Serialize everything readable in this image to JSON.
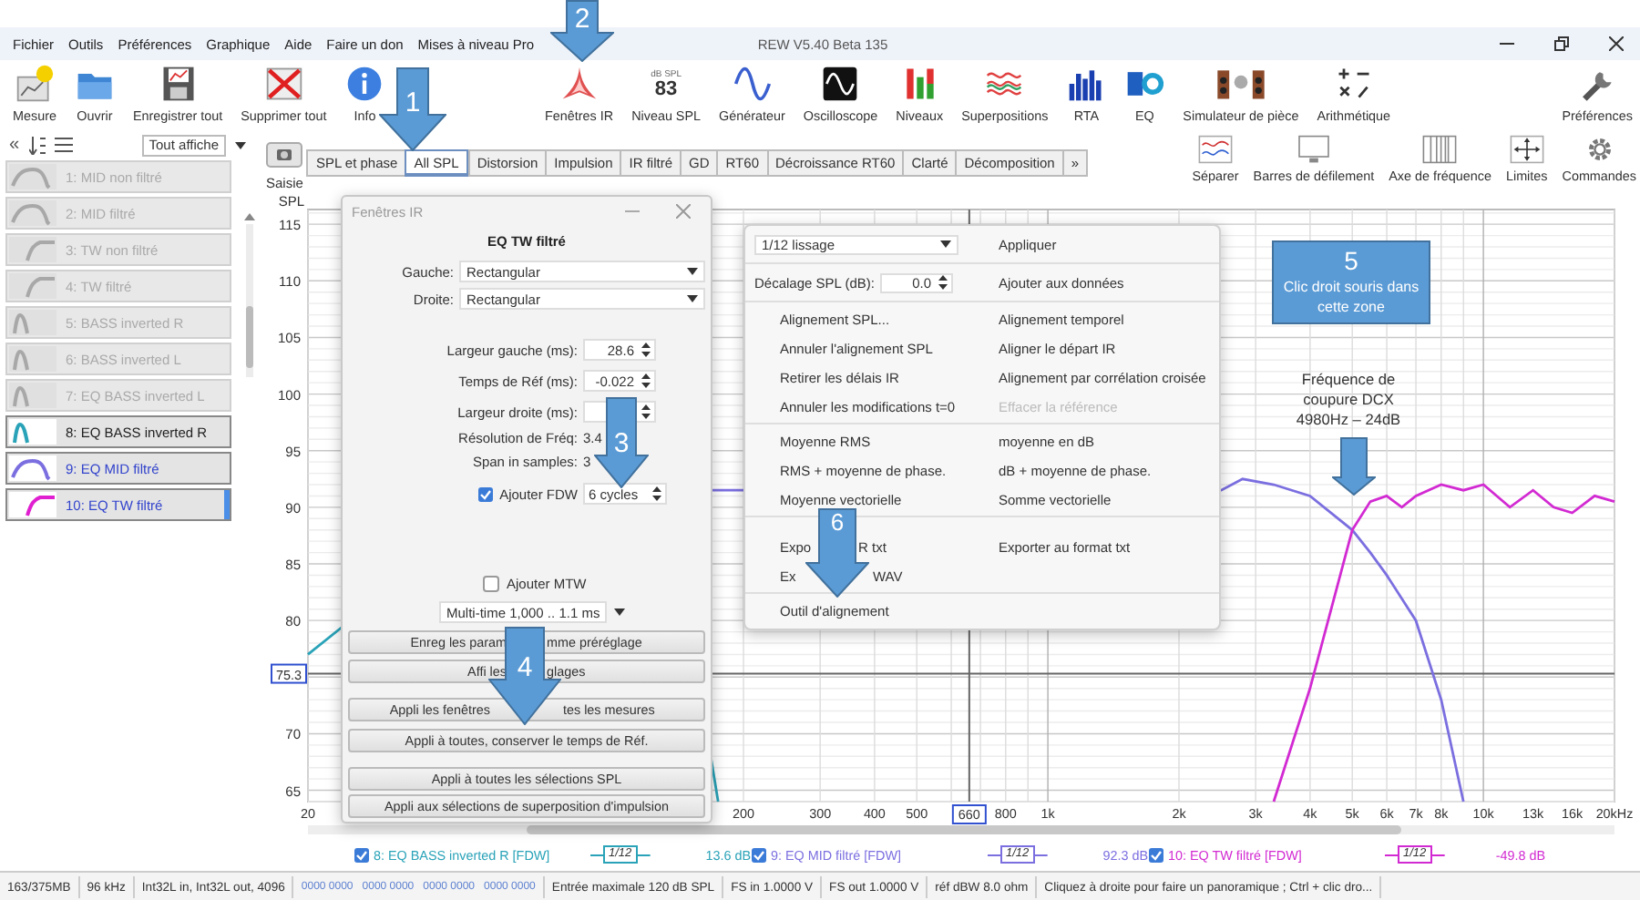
{
  "window": {
    "title": "REW V5.40 Beta 135"
  },
  "menu": [
    "Fichier",
    "Outils",
    "Préférences",
    "Graphique",
    "Aide",
    "Faire un don",
    "Mises à niveau Pro"
  ],
  "toolbar": {
    "left": [
      {
        "kind": "measure",
        "label": "Mesure"
      },
      {
        "kind": "open",
        "label": "Ouvrir"
      },
      {
        "kind": "save",
        "label": "Enregistrer tout"
      },
      {
        "kind": "delete",
        "label": "Supprimer tout"
      },
      {
        "kind": "info",
        "label": "Info"
      }
    ],
    "center": [
      {
        "kind": "ir",
        "label": "Fenêtres IR"
      },
      {
        "kind": "spl",
        "label": "Niveau SPL",
        "readout_unit": "dB SPL",
        "readout": "83"
      },
      {
        "kind": "generator",
        "label": "Générateur"
      },
      {
        "kind": "scope",
        "label": "Oscilloscope"
      },
      {
        "kind": "levels",
        "label": "Niveaux"
      },
      {
        "kind": "overlays",
        "label": "Superpositions"
      },
      {
        "kind": "rta",
        "label": "RTA"
      },
      {
        "kind": "eq",
        "label": "EQ"
      },
      {
        "kind": "room",
        "label": "Simulateur de pièce"
      },
      {
        "kind": "arith",
        "label": "Arithmétique"
      }
    ],
    "right": [
      {
        "kind": "prefs",
        "label": "Préférences"
      }
    ]
  },
  "sidebar": {
    "collapse": "«",
    "filter": "Tout affiche",
    "measurements": [
      {
        "label": "1: MID non filtré",
        "kind": "mid",
        "shown": false,
        "selected": false,
        "current": false,
        "color": "#a8a8a8"
      },
      {
        "label": "2: MID filtré",
        "kind": "mid",
        "shown": false,
        "selected": false,
        "current": false,
        "color": "#a8a8a8"
      },
      {
        "label": "3: TW non filtré",
        "kind": "tw",
        "shown": false,
        "selected": false,
        "current": false,
        "color": "#a8a8a8"
      },
      {
        "label": "4: TW filtré",
        "kind": "tw",
        "shown": false,
        "selected": false,
        "current": false,
        "color": "#a8a8a8"
      },
      {
        "label": "5: BASS inverted R",
        "kind": "bass",
        "shown": false,
        "selected": false,
        "current": false,
        "color": "#a8a8a8"
      },
      {
        "label": "6: BASS inverted L",
        "kind": "bass",
        "shown": false,
        "selected": false,
        "current": false,
        "color": "#a8a8a8"
      },
      {
        "label": "7: EQ BASS inverted L",
        "kind": "bass",
        "shown": false,
        "selected": false,
        "current": false,
        "color": "#a8a8a8"
      },
      {
        "label": "8: EQ BASS inverted R",
        "kind": "bass",
        "shown": true,
        "selected": false,
        "current": false,
        "color": "#2aa3b8"
      },
      {
        "label": "9: EQ MID filtré",
        "kind": "mid",
        "shown": true,
        "selected": true,
        "current": false,
        "color": "#7b6fe0"
      },
      {
        "label": "10: EQ TW filtré",
        "kind": "tw",
        "shown": true,
        "selected": true,
        "current": true,
        "color": "#e020d0"
      }
    ]
  },
  "capture": {
    "label": "Saisie"
  },
  "tabs": [
    {
      "label": "SPL et phase",
      "selected": false
    },
    {
      "label": "All SPL",
      "selected": true
    },
    {
      "label": "Distorsion",
      "selected": false
    },
    {
      "label": "Impulsion",
      "selected": false
    },
    {
      "label": "IR filtré",
      "selected": false
    },
    {
      "label": "GD",
      "selected": false
    },
    {
      "label": "RT60",
      "selected": false
    },
    {
      "label": "Décroissance RT60",
      "selected": false
    },
    {
      "label": "Clarté",
      "selected": false
    },
    {
      "label": "Décomposition",
      "selected": false
    }
  ],
  "tabs_overflow": "»",
  "view_tools": [
    {
      "kind": "split",
      "label": "Séparer"
    },
    {
      "kind": "scrollbars",
      "label": "Barres de défilement"
    },
    {
      "kind": "freq_axis",
      "label": "Axe de fréquence"
    },
    {
      "kind": "limits",
      "label": "Limites"
    },
    {
      "kind": "commands",
      "label": "Commandes"
    }
  ],
  "chart": {
    "y_axis_title": "SPL",
    "y_axis_labels": [
      "115",
      "110",
      "105",
      "100",
      "95",
      "90",
      "85",
      "80",
      "70",
      "65"
    ],
    "x_axis_labels": [
      "20",
      "200",
      "300",
      "400",
      "500",
      "800",
      "1k",
      "2k",
      "3k",
      "4k",
      "5k",
      "6k",
      "7k",
      "8k",
      "10k",
      "13k",
      "16k",
      "20kHz"
    ],
    "cursor": {
      "x_readout": "660",
      "y_readout": "75.3"
    }
  },
  "ir_windows_dialog": {
    "title": "Fenêtres IR",
    "heading": "EQ TW filtré",
    "window_selects": [
      {
        "label": "Gauche:",
        "value": "Rectangular"
      },
      {
        "label": "Droite:",
        "value": "Rectangular"
      }
    ],
    "fields": [
      {
        "kind": "spinner",
        "label": "Largeur gauche (ms):",
        "value": "28.6"
      },
      {
        "kind": "spinner",
        "label": "Temps de Réf (ms):",
        "value": "-0.022"
      },
      {
        "kind": "spinner",
        "label": "Largeur droite (ms):"
      },
      {
        "kind": "readout",
        "label": "Résolution de Fréq:",
        "value": "3.4"
      },
      {
        "kind": "readout",
        "label": "Span in samples:",
        "value": "3"
      }
    ],
    "fdw": {
      "label": "Ajouter FDW",
      "checked": true,
      "value": "6 cycles"
    },
    "mtw": {
      "label": "Ajouter MTW",
      "checked": false
    },
    "multi_time": "Multi-time 1,000 .. 1.1 ms",
    "buttons": [
      {
        "parts": [
          "Enreg les param",
          "mme préréglage"
        ]
      },
      {
        "parts": [
          "Affi les",
          "glages"
        ]
      },
      {
        "parts": [
          "Appli les fenêtres",
          "tes les mesures"
        ]
      },
      {
        "text": "Appli à toutes, conserver le temps de Réf."
      },
      {
        "text": "Appli à toutes les sélections SPL"
      },
      {
        "text": "Appli aux sélections de superposition d'impulsion"
      }
    ]
  },
  "context_menu": {
    "smoothing": {
      "value": "1/12 lissage",
      "action": "Appliquer"
    },
    "offset": {
      "label": "Décalage SPL (dB):",
      "value": "0.0",
      "action": "Ajouter aux données"
    },
    "groups": [
      {
        "left": [
          {
            "label": "Alignement SPL...",
            "disabled": false
          },
          {
            "label": "Annuler l'alignement SPL",
            "disabled": false
          },
          {
            "label": "Retirer les délais IR",
            "disabled": false
          },
          {
            "label": "Annuler les modifications t=0",
            "disabled": false
          }
        ],
        "right": [
          {
            "label": "Alignement temporel",
            "disabled": false
          },
          {
            "label": "Aligner le départ IR",
            "disabled": false
          },
          {
            "label": "Alignement par corrélation croisée",
            "disabled": false
          },
          {
            "label": "Effacer la référence",
            "disabled": true
          }
        ]
      },
      {
        "left": [
          {
            "label": "Moyenne RMS",
            "disabled": false
          },
          {
            "label": "RMS + moyenne de phase.",
            "disabled": false
          },
          {
            "label": "Moyenne vectorielle",
            "disabled": false
          }
        ],
        "right": [
          {
            "label": "moyenne en dB",
            "disabled": false
          },
          {
            "label": "dB + moyenne de phase.",
            "disabled": false
          },
          {
            "label": "Somme vectorielle",
            "disabled": false
          }
        ]
      },
      {
        "left": [
          {
            "parts": [
              "Expo",
              "R txt"
            ],
            "disabled": false
          },
          {
            "parts": [
              "Ex",
              "WAV"
            ],
            "disabled": false
          }
        ],
        "right": [
          {
            "label": "Exporter au format txt",
            "disabled": false
          }
        ]
      },
      {
        "left": [
          {
            "label": "Outil d'alignement",
            "disabled": false
          }
        ]
      }
    ]
  },
  "callouts": [
    {
      "kind": "arrow",
      "number": "1"
    },
    {
      "kind": "arrow",
      "number": "2"
    },
    {
      "kind": "arrow",
      "number": "3"
    },
    {
      "kind": "arrow",
      "number": "4"
    },
    {
      "kind": "box",
      "number": "5",
      "text": "Clic droit souris dans cette zone"
    },
    {
      "kind": "arrow",
      "number": "6"
    }
  ],
  "note": {
    "text": "Fréquence de coupure DCX 4980Hz – 24dB"
  },
  "legend": [
    {
      "label": "8: EQ BASS inverted R [FDW]",
      "checked": true,
      "smoothing": "1/12",
      "value": "13.6 dB",
      "color": "#2aa3b8"
    },
    {
      "label": "9: EQ MID filtré [FDW]",
      "checked": true,
      "smoothing": "1/12",
      "value": "92.3 dB",
      "color": "#7b6fe0"
    },
    {
      "label": "10: EQ TW filtré [FDW]",
      "checked": true,
      "smoothing": "1/12",
      "value": "-49.8 dB",
      "color": "#d22ad2"
    }
  ],
  "status_bar": [
    {
      "kind": "text",
      "text": "163/375MB"
    },
    {
      "kind": "text",
      "text": "96 kHz"
    },
    {
      "kind": "text",
      "text": "Int32L in, Int32L out, 4096"
    },
    {
      "kind": "meters",
      "meters": [
        "0000 0000",
        "0000 0000",
        "0000 0000",
        "0000 0000"
      ]
    },
    {
      "kind": "text",
      "text": "Entrée maximale 120 dB SPL"
    },
    {
      "kind": "text",
      "text": "FS in 1.0000 V"
    },
    {
      "kind": "text",
      "text": "FS out 1.0000 V"
    },
    {
      "kind": "text",
      "text": "réf dBW 8.0 ohm"
    },
    {
      "kind": "text",
      "text": "Cliquez à droite pour faire un panoramique ; Ctrl + clic dro..."
    }
  ]
}
